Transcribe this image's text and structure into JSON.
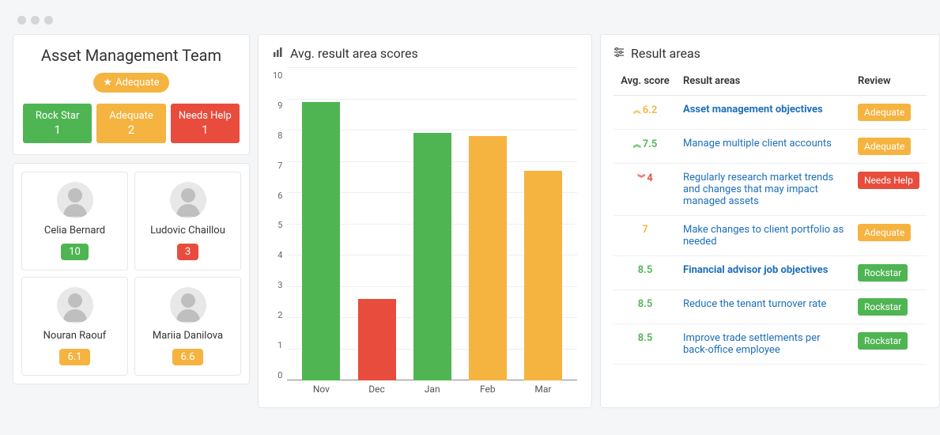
{
  "team": {
    "title": "Asset Management Team",
    "badge_label": "Adequate",
    "statuses": [
      {
        "label": "Rock Star",
        "count": "1",
        "color": "#4fb553"
      },
      {
        "label": "Adequate",
        "count": "2",
        "color": "#f5b340"
      },
      {
        "label": "Needs Help",
        "count": "1",
        "color": "#e84c3d"
      }
    ],
    "people": [
      {
        "name": "Celia Bernard",
        "score": "10",
        "color": "#4fb553"
      },
      {
        "name": "Ludovic Chaillou",
        "score": "3",
        "color": "#e84c3d"
      },
      {
        "name": "Nouran Raouf",
        "score": "6.1",
        "color": "#f5b340"
      },
      {
        "name": "Mariia Danilova",
        "score": "6.6",
        "color": "#f5b340"
      }
    ]
  },
  "chart_title": "Avg. result area scores",
  "chart_data": {
    "type": "bar",
    "title": "Avg. result area scores",
    "xlabel": "",
    "ylabel": "",
    "ylim": [
      0,
      10
    ],
    "yticks": [
      0,
      1,
      2,
      3,
      4,
      5,
      6,
      7,
      8,
      9,
      10
    ],
    "categories": [
      "Nov",
      "Dec",
      "Jan",
      "Feb",
      "Mar"
    ],
    "values": [
      8.9,
      2.6,
      7.9,
      7.8,
      6.7
    ],
    "colors": [
      "#4fb553",
      "#e84c3d",
      "#4fb553",
      "#f5b340",
      "#f5b340"
    ]
  },
  "results": {
    "title": "Result areas",
    "headers": {
      "score": "Avg. score",
      "area": "Result areas",
      "review": "Review"
    },
    "rows": [
      {
        "score": "6.2",
        "score_color": "#f5b340",
        "trend": "up",
        "area": "Asset management objectives",
        "bold": true,
        "review": "Adequate",
        "review_color": "#f5b340"
      },
      {
        "score": "7.5",
        "score_color": "#4fb553",
        "trend": "up",
        "area": "Manage multiple client accounts",
        "bold": false,
        "review": "Adequate",
        "review_color": "#f5b340"
      },
      {
        "score": "4",
        "score_color": "#e84c3d",
        "trend": "down",
        "area": "Regularly research market trends and changes that may impact managed assets",
        "bold": false,
        "review": "Needs Help",
        "review_color": "#e84c3d"
      },
      {
        "score": "7",
        "score_color": "#f5b340",
        "trend": "",
        "area": "Make changes to client portfolio as needed",
        "bold": false,
        "review": "Adequate",
        "review_color": "#f5b340"
      },
      {
        "score": "8.5",
        "score_color": "#4fb553",
        "trend": "",
        "area": "Financial advisor job objectives",
        "bold": true,
        "review": "Rockstar",
        "review_color": "#4fb553"
      },
      {
        "score": "8.5",
        "score_color": "#4fb553",
        "trend": "",
        "area": "Reduce the tenant turnover rate",
        "bold": false,
        "review": "Rockstar",
        "review_color": "#4fb553"
      },
      {
        "score": "8.5",
        "score_color": "#4fb553",
        "trend": "",
        "area": "Improve trade settlements per back-office employee",
        "bold": false,
        "review": "Rockstar",
        "review_color": "#4fb553"
      }
    ]
  }
}
